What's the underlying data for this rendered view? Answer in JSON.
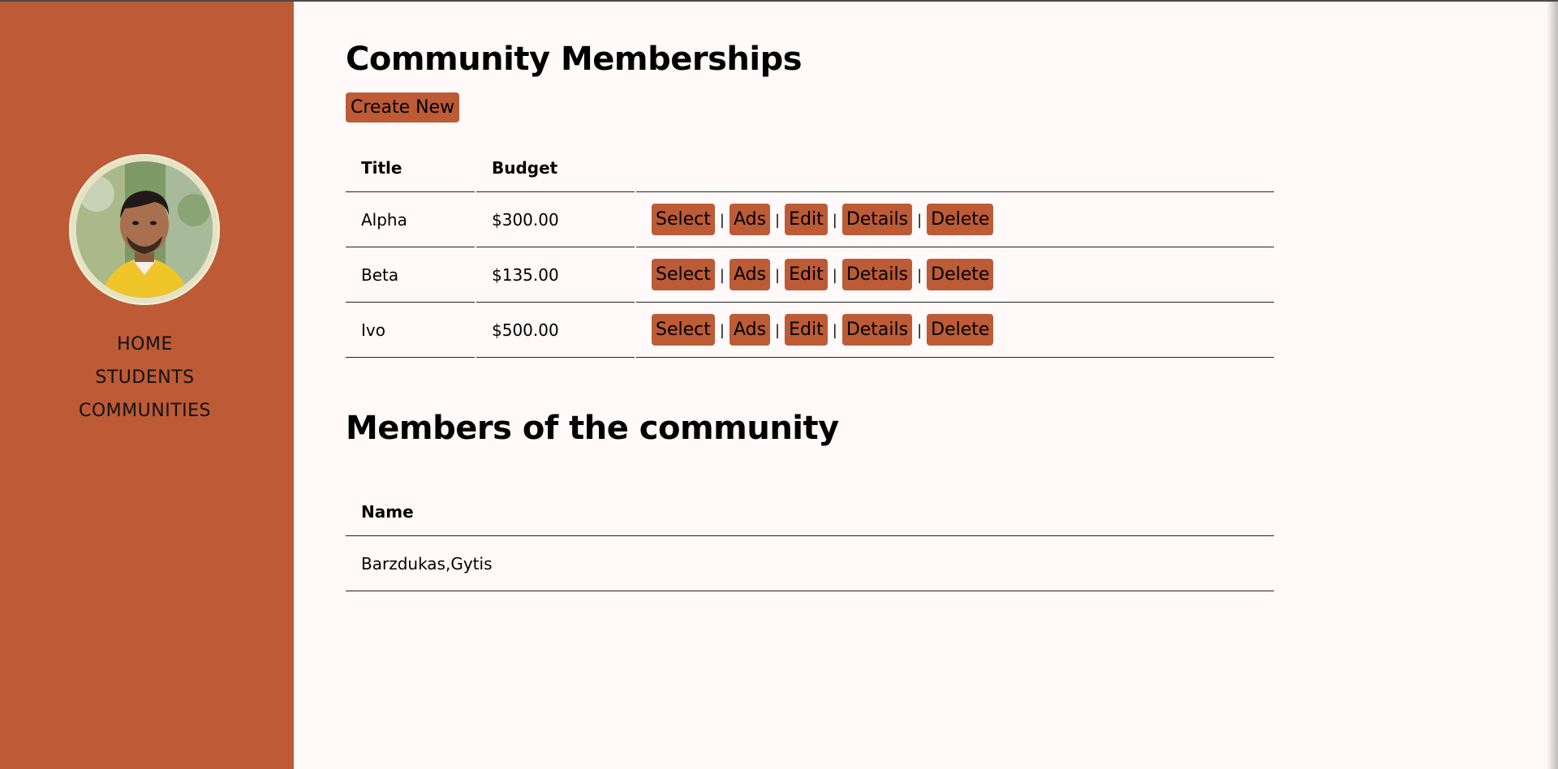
{
  "sidebar": {
    "nav": [
      {
        "label": "HOME"
      },
      {
        "label": "STUDENTS"
      },
      {
        "label": "COMMUNITIES"
      }
    ]
  },
  "page": {
    "title": "Community Memberships",
    "create_new_label": "Create New"
  },
  "memberships_table": {
    "headers": [
      "Title",
      "Budget",
      ""
    ],
    "rows": [
      {
        "title": "Alpha",
        "budget": "$300.00"
      },
      {
        "title": "Beta",
        "budget": "$135.00"
      },
      {
        "title": "Ivo",
        "budget": "$500.00"
      }
    ],
    "actions": {
      "select": "Select",
      "ads": "Ads",
      "edit": "Edit",
      "details": "Details",
      "delete": "Delete",
      "separator": "|"
    }
  },
  "members_section": {
    "title": "Members of the community",
    "headers": [
      "Name"
    ],
    "rows": [
      {
        "name": "Barzdukas,Gytis"
      }
    ]
  },
  "colors": {
    "accent": "#bc5b36",
    "background": "#fff9f9"
  }
}
